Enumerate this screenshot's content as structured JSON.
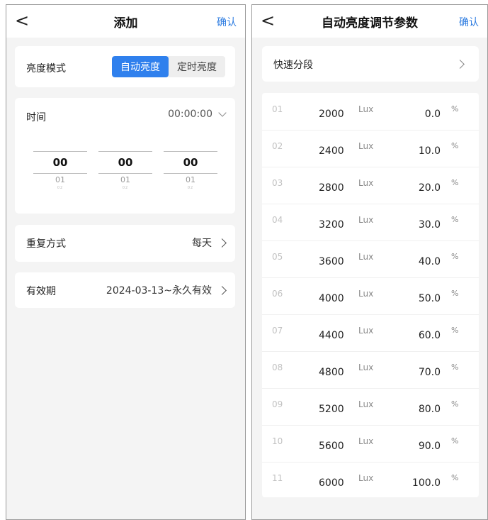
{
  "left": {
    "nav": {
      "back_icon": "chevron-left-icon",
      "back": "<",
      "title": "添加",
      "confirm": "确认"
    },
    "mode": {
      "label": "亮度模式",
      "options": [
        "自动亮度",
        "定时亮度"
      ],
      "selected": "自动亮度"
    },
    "time": {
      "label": "时间",
      "value": "00:00:00",
      "picker": {
        "hours": {
          "selected": "00",
          "next": "01",
          "next2": "02"
        },
        "minutes": {
          "selected": "00",
          "next": "01",
          "next2": "02"
        },
        "seconds": {
          "selected": "00",
          "next": "01",
          "next2": "02"
        }
      }
    },
    "repeat": {
      "label": "重复方式",
      "value": "每天"
    },
    "validity": {
      "label": "有效期",
      "value": "2024-03-13~永久有效"
    }
  },
  "right": {
    "nav": {
      "back": "<",
      "title": "自动亮度调节参数",
      "confirm": "确认"
    },
    "quick": {
      "label": "快速分段"
    },
    "unit_lux": "Lux",
    "unit_pct": "%",
    "rows": [
      {
        "idx": "01",
        "lux": "2000",
        "pct": "0.0"
      },
      {
        "idx": "02",
        "lux": "2400",
        "pct": "10.0"
      },
      {
        "idx": "03",
        "lux": "2800",
        "pct": "20.0"
      },
      {
        "idx": "04",
        "lux": "3200",
        "pct": "30.0"
      },
      {
        "idx": "05",
        "lux": "3600",
        "pct": "40.0"
      },
      {
        "idx": "06",
        "lux": "4000",
        "pct": "50.0"
      },
      {
        "idx": "07",
        "lux": "4400",
        "pct": "60.0"
      },
      {
        "idx": "08",
        "lux": "4800",
        "pct": "70.0"
      },
      {
        "idx": "09",
        "lux": "5200",
        "pct": "80.0"
      },
      {
        "idx": "10",
        "lux": "5600",
        "pct": "90.0"
      },
      {
        "idx": "11",
        "lux": "6000",
        "pct": "100.0"
      }
    ]
  },
  "colors": {
    "accent": "#2f80ed",
    "link": "#2f7de1",
    "background": "#f4f4f4"
  }
}
